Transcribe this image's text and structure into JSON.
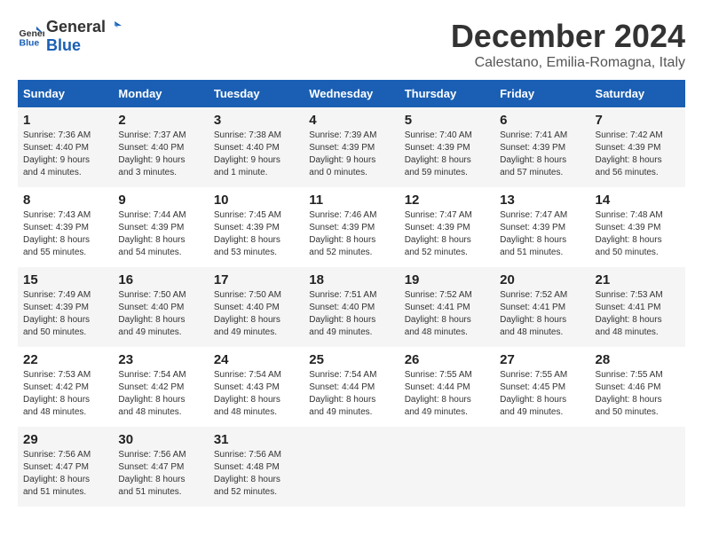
{
  "logo": {
    "text_general": "General",
    "text_blue": "Blue"
  },
  "title": "December 2024",
  "subtitle": "Calestano, Emilia-Romagna, Italy",
  "weekdays": [
    "Sunday",
    "Monday",
    "Tuesday",
    "Wednesday",
    "Thursday",
    "Friday",
    "Saturday"
  ],
  "weeks": [
    [
      {
        "day": "1",
        "info": "Sunrise: 7:36 AM\nSunset: 4:40 PM\nDaylight: 9 hours\nand 4 minutes."
      },
      {
        "day": "2",
        "info": "Sunrise: 7:37 AM\nSunset: 4:40 PM\nDaylight: 9 hours\nand 3 minutes."
      },
      {
        "day": "3",
        "info": "Sunrise: 7:38 AM\nSunset: 4:40 PM\nDaylight: 9 hours\nand 1 minute."
      },
      {
        "day": "4",
        "info": "Sunrise: 7:39 AM\nSunset: 4:39 PM\nDaylight: 9 hours\nand 0 minutes."
      },
      {
        "day": "5",
        "info": "Sunrise: 7:40 AM\nSunset: 4:39 PM\nDaylight: 8 hours\nand 59 minutes."
      },
      {
        "day": "6",
        "info": "Sunrise: 7:41 AM\nSunset: 4:39 PM\nDaylight: 8 hours\nand 57 minutes."
      },
      {
        "day": "7",
        "info": "Sunrise: 7:42 AM\nSunset: 4:39 PM\nDaylight: 8 hours\nand 56 minutes."
      }
    ],
    [
      {
        "day": "8",
        "info": "Sunrise: 7:43 AM\nSunset: 4:39 PM\nDaylight: 8 hours\nand 55 minutes."
      },
      {
        "day": "9",
        "info": "Sunrise: 7:44 AM\nSunset: 4:39 PM\nDaylight: 8 hours\nand 54 minutes."
      },
      {
        "day": "10",
        "info": "Sunrise: 7:45 AM\nSunset: 4:39 PM\nDaylight: 8 hours\nand 53 minutes."
      },
      {
        "day": "11",
        "info": "Sunrise: 7:46 AM\nSunset: 4:39 PM\nDaylight: 8 hours\nand 52 minutes."
      },
      {
        "day": "12",
        "info": "Sunrise: 7:47 AM\nSunset: 4:39 PM\nDaylight: 8 hours\nand 52 minutes."
      },
      {
        "day": "13",
        "info": "Sunrise: 7:47 AM\nSunset: 4:39 PM\nDaylight: 8 hours\nand 51 minutes."
      },
      {
        "day": "14",
        "info": "Sunrise: 7:48 AM\nSunset: 4:39 PM\nDaylight: 8 hours\nand 50 minutes."
      }
    ],
    [
      {
        "day": "15",
        "info": "Sunrise: 7:49 AM\nSunset: 4:39 PM\nDaylight: 8 hours\nand 50 minutes."
      },
      {
        "day": "16",
        "info": "Sunrise: 7:50 AM\nSunset: 4:40 PM\nDaylight: 8 hours\nand 49 minutes."
      },
      {
        "day": "17",
        "info": "Sunrise: 7:50 AM\nSunset: 4:40 PM\nDaylight: 8 hours\nand 49 minutes."
      },
      {
        "day": "18",
        "info": "Sunrise: 7:51 AM\nSunset: 4:40 PM\nDaylight: 8 hours\nand 49 minutes."
      },
      {
        "day": "19",
        "info": "Sunrise: 7:52 AM\nSunset: 4:41 PM\nDaylight: 8 hours\nand 48 minutes."
      },
      {
        "day": "20",
        "info": "Sunrise: 7:52 AM\nSunset: 4:41 PM\nDaylight: 8 hours\nand 48 minutes."
      },
      {
        "day": "21",
        "info": "Sunrise: 7:53 AM\nSunset: 4:41 PM\nDaylight: 8 hours\nand 48 minutes."
      }
    ],
    [
      {
        "day": "22",
        "info": "Sunrise: 7:53 AM\nSunset: 4:42 PM\nDaylight: 8 hours\nand 48 minutes."
      },
      {
        "day": "23",
        "info": "Sunrise: 7:54 AM\nSunset: 4:42 PM\nDaylight: 8 hours\nand 48 minutes."
      },
      {
        "day": "24",
        "info": "Sunrise: 7:54 AM\nSunset: 4:43 PM\nDaylight: 8 hours\nand 48 minutes."
      },
      {
        "day": "25",
        "info": "Sunrise: 7:54 AM\nSunset: 4:44 PM\nDaylight: 8 hours\nand 49 minutes."
      },
      {
        "day": "26",
        "info": "Sunrise: 7:55 AM\nSunset: 4:44 PM\nDaylight: 8 hours\nand 49 minutes."
      },
      {
        "day": "27",
        "info": "Sunrise: 7:55 AM\nSunset: 4:45 PM\nDaylight: 8 hours\nand 49 minutes."
      },
      {
        "day": "28",
        "info": "Sunrise: 7:55 AM\nSunset: 4:46 PM\nDaylight: 8 hours\nand 50 minutes."
      }
    ],
    [
      {
        "day": "29",
        "info": "Sunrise: 7:56 AM\nSunset: 4:47 PM\nDaylight: 8 hours\nand 51 minutes."
      },
      {
        "day": "30",
        "info": "Sunrise: 7:56 AM\nSunset: 4:47 PM\nDaylight: 8 hours\nand 51 minutes."
      },
      {
        "day": "31",
        "info": "Sunrise: 7:56 AM\nSunset: 4:48 PM\nDaylight: 8 hours\nand 52 minutes."
      },
      null,
      null,
      null,
      null
    ]
  ]
}
